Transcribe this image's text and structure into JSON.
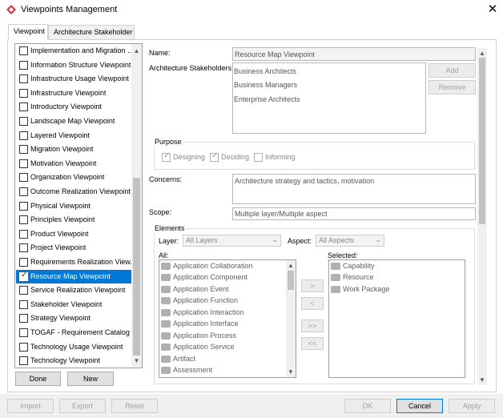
{
  "window": {
    "title": "Viewpoints Management",
    "close": "✕"
  },
  "tabs": [
    {
      "label": "Viewpoint"
    },
    {
      "label": "Architecture Stakeholder"
    }
  ],
  "viewpoints": [
    {
      "label": "Implementation and Migration ...",
      "checked": false
    },
    {
      "label": "Information Structure Viewpoint",
      "checked": false
    },
    {
      "label": "Infrastructure Usage Viewpoint",
      "checked": false
    },
    {
      "label": "Infrastructure Viewpoint",
      "checked": false
    },
    {
      "label": "Introductory Viewpoint",
      "checked": false
    },
    {
      "label": "Landscape Map Viewpoint",
      "checked": false
    },
    {
      "label": "Layered Viewpoint",
      "checked": false
    },
    {
      "label": "Migration Viewpoint",
      "checked": false
    },
    {
      "label": "Motivation Viewpoint",
      "checked": false
    },
    {
      "label": "Organization Viewpoint",
      "checked": false
    },
    {
      "label": "Outcome Realization Viewpoint",
      "checked": false
    },
    {
      "label": "Physical Viewpoint",
      "checked": false
    },
    {
      "label": "Principles Viewpoint",
      "checked": false
    },
    {
      "label": "Product Viewpoint",
      "checked": false
    },
    {
      "label": "Project Viewpoint",
      "checked": false
    },
    {
      "label": "Requirements Realization View...",
      "checked": false
    },
    {
      "label": "Resource Map Viewpoint",
      "checked": true,
      "selected": true
    },
    {
      "label": "Service Realization Viewpoint",
      "checked": false
    },
    {
      "label": "Stakeholder Viewpoint",
      "checked": false
    },
    {
      "label": "Strategy Viewpoint",
      "checked": false
    },
    {
      "label": "TOGAF - Requirement Catalog",
      "checked": false
    },
    {
      "label": "Technology Usage Viewpoint",
      "checked": false
    },
    {
      "label": "Technology Viewpoint",
      "checked": false
    }
  ],
  "list_buttons": {
    "done": "Done",
    "new": "New"
  },
  "form": {
    "name_label": "Name:",
    "name_value": "Resource Map Viewpoint",
    "stakeholders_label": "Architecture Stakeholders:",
    "stakeholders": [
      "Business Architects",
      "Business Managers",
      "Enterprise Architects"
    ],
    "add": "Add",
    "remove": "Remove",
    "purpose_label": "Purpose",
    "purpose": [
      {
        "label": "Designing",
        "checked": true
      },
      {
        "label": "Deciding",
        "checked": true
      },
      {
        "label": "Informing",
        "checked": false
      }
    ],
    "concerns_label": "Concerns:",
    "concerns_value": "Architecture strategy and tactics, motivation",
    "scope_label": "Scope:",
    "scope_value": "Multiple layer/Multiple aspect",
    "elements_label": "Elements",
    "layer_label": "Layer:",
    "layer_value": "All Layers",
    "aspect_label": "Aspect:",
    "aspect_value": "All Aspects",
    "all_label": "All:",
    "selected_label": "Selected:",
    "all_items": [
      "Application Collaboration",
      "Application Component",
      "Application Event",
      "Application Function",
      "Application Interaction",
      "Application Interface",
      "Application Process",
      "Application Service",
      "Artifact",
      "Assessment"
    ],
    "selected_items": [
      "Capability",
      "Resource",
      "Work Package"
    ],
    "move_buttons": [
      ">",
      "<",
      ">>",
      "<<"
    ]
  },
  "footer": {
    "import": "Import",
    "export": "Export",
    "reset": "Reset",
    "ok": "OK",
    "cancel": "Cancel",
    "apply": "Apply"
  },
  "colors": {
    "selection": "#0078d7",
    "app_icon": "#d9363e"
  }
}
